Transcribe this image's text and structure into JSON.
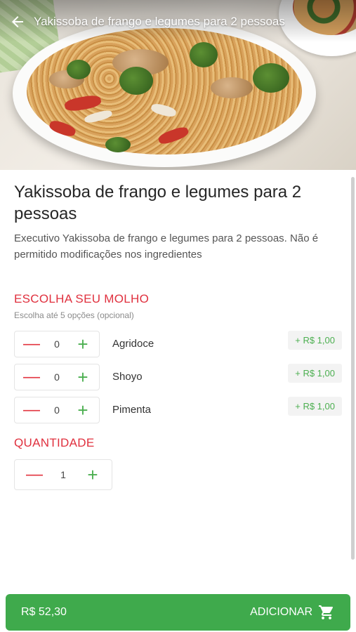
{
  "header": {
    "title": "Yakissoba de frango e legumes para 2 pessoas",
    "back_icon": "arrow-left-icon"
  },
  "product": {
    "title": "Yakissoba de frango e legumes para 2 pessoas",
    "description": "Executivo Yakissoba de frango e legumes para 2 pessoas. Não é permitido modificações nos ingredientes"
  },
  "sauce": {
    "title": "ESCOLHA SEU MOLHO",
    "subtitle": "Escolha até 5 opções (opcional)",
    "options": [
      {
        "name": "Agridoce",
        "qty": "0",
        "price": "+ R$ 1,00"
      },
      {
        "name": "Shoyo",
        "qty": "0",
        "price": "+ R$ 1,00"
      },
      {
        "name": "Pimenta",
        "qty": "0",
        "price": "+ R$ 1,00"
      }
    ]
  },
  "quantity": {
    "title": "QUANTIDADE",
    "value": "1"
  },
  "stepper": {
    "minus": "—",
    "plus": "+"
  },
  "footer": {
    "price": "R$ 52,30",
    "add_label": "ADICIONAR",
    "cart_icon": "cart-icon"
  },
  "colors": {
    "accent_red": "#e0303e",
    "accent_green": "#3faa4c"
  }
}
